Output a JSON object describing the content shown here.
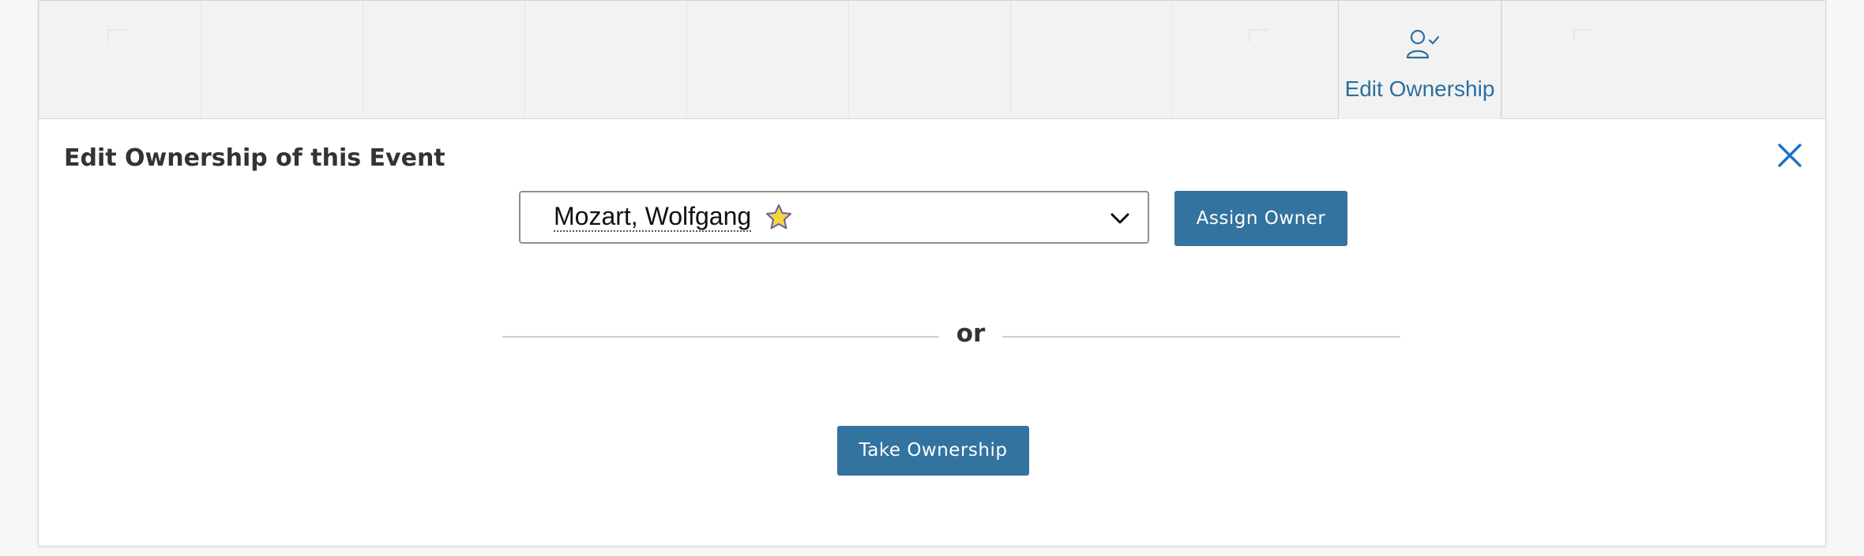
{
  "toolbar": {
    "edit_ownership_label": "Edit Ownership",
    "edit_ownership_icon": "user-check-icon",
    "icon_color": "#2e6e9e"
  },
  "panel": {
    "title": "Edit Ownership of this Event",
    "close_icon": "close-icon",
    "owner_select": {
      "value": "Mozart, Wolfgang",
      "favorite_icon": "star-icon",
      "dropdown_icon": "chevron-down-icon"
    },
    "assign_button_label": "Assign Owner",
    "divider_text": "or",
    "take_button_label": "Take Ownership"
  },
  "colors": {
    "button_bg": "#33739f",
    "close_icon": "#1a73c8",
    "star_fill": "#f5d63d"
  }
}
